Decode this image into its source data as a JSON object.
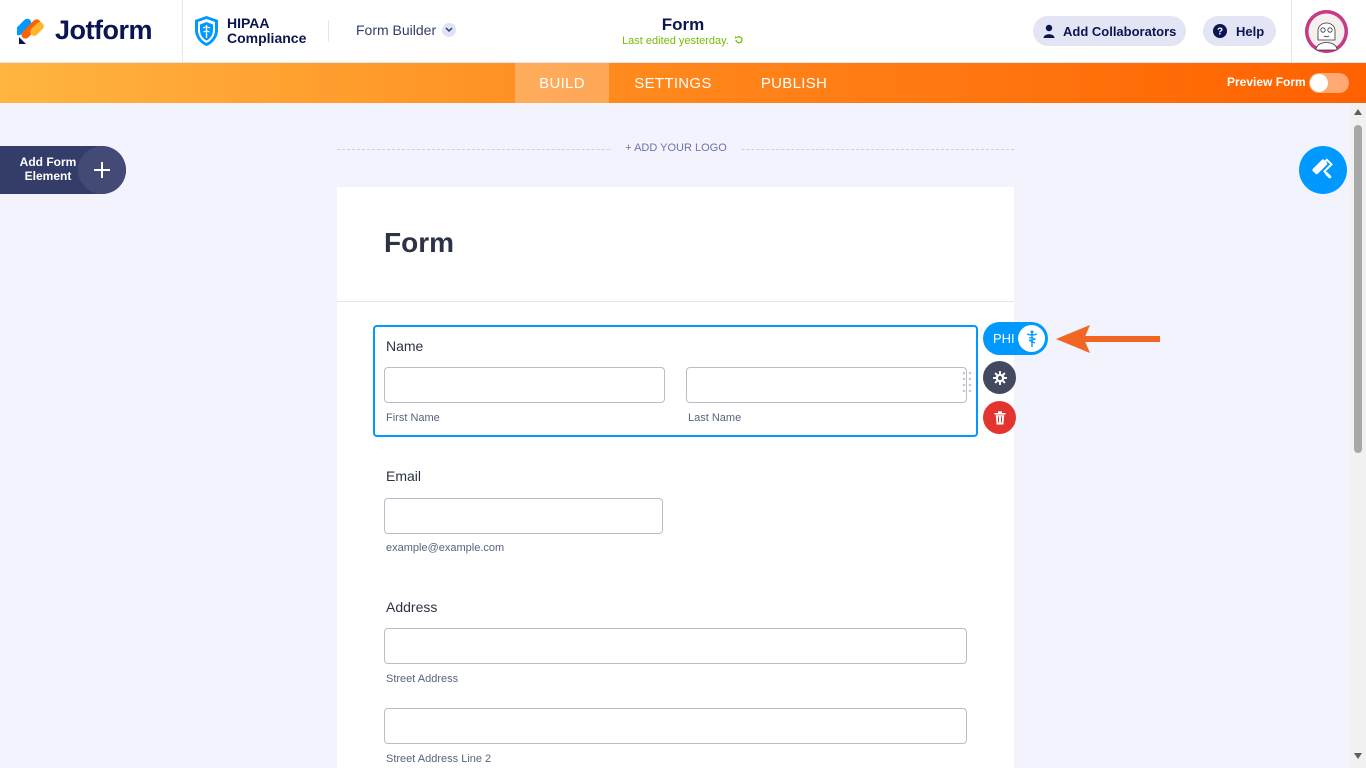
{
  "brand": {
    "name": "Jotform"
  },
  "hipaa": {
    "line1": "HIPAA",
    "line2": "Compliance"
  },
  "header": {
    "builder_menu": "Form Builder",
    "form_title": "Form",
    "last_edited": "Last edited yesterday.",
    "collaborators_label": "Add Collaborators",
    "help_label": "Help"
  },
  "nav": {
    "tabs": [
      {
        "label": "BUILD",
        "active": true
      },
      {
        "label": "SETTINGS",
        "active": false
      },
      {
        "label": "PUBLISH",
        "active": false
      }
    ],
    "preview_label": "Preview Form"
  },
  "sidebar": {
    "add_element_label": "Add Form Element"
  },
  "logo_area": {
    "add_logo_label": "+ ADD YOUR LOGO"
  },
  "form": {
    "title": "Form",
    "fields": {
      "name": {
        "label": "Name",
        "first": "First Name",
        "last": "Last Name"
      },
      "email": {
        "label": "Email",
        "sublabel": "example@example.com"
      },
      "address": {
        "label": "Address",
        "line1": "Street Address",
        "line2": "Street Address Line 2"
      }
    }
  },
  "field_toolbar": {
    "phi_label": "PHI"
  },
  "colors": {
    "accent": "#0099ff",
    "nav_orange": "#ff6100",
    "danger": "#e3342f",
    "navy": "#0a1551"
  }
}
